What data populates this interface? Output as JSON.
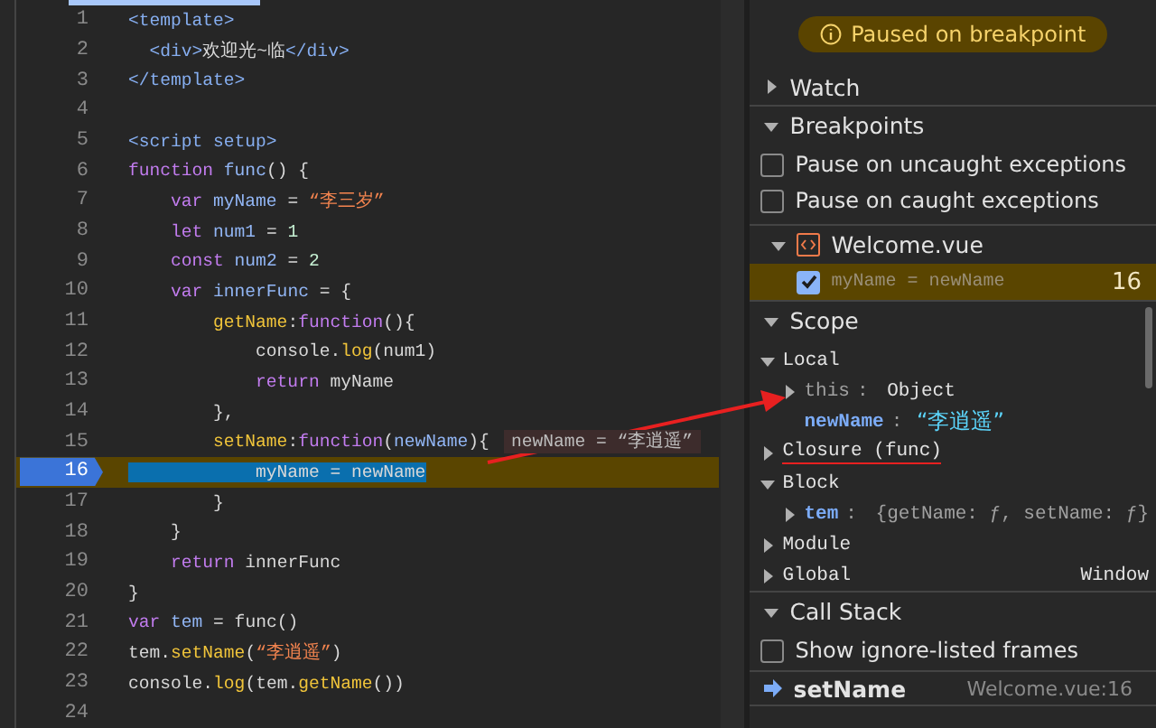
{
  "editor": {
    "lines": [
      {
        "number": "1",
        "current": false,
        "tokens": [
          {
            "text": "<template>",
            "kind": "tag"
          }
        ]
      },
      {
        "number": "2",
        "current": false,
        "tokens": [
          {
            "text": "  <div>",
            "kind": "tag"
          },
          {
            "text": "欢迎光~临",
            "kind": "plain"
          },
          {
            "text": "</div>",
            "kind": "tag"
          }
        ]
      },
      {
        "number": "3",
        "current": false,
        "tokens": [
          {
            "text": "</template>",
            "kind": "tag"
          }
        ]
      },
      {
        "number": "4",
        "current": false
      },
      {
        "number": "5",
        "current": false,
        "tokens": [
          {
            "text": "<script setup>",
            "kind": "tag"
          }
        ]
      },
      {
        "number": "6",
        "current": false,
        "tokens": [
          {
            "text": "function",
            "kind": "keyword"
          },
          {
            "text": " func",
            "kind": "ident"
          },
          {
            "text": "() {",
            "kind": "plain"
          }
        ]
      },
      {
        "number": "7",
        "current": false,
        "tokens": [
          {
            "text": "    var",
            "kind": "keyword"
          },
          {
            "text": " myName",
            "kind": "ident"
          },
          {
            "text": " = ",
            "kind": "plain"
          },
          {
            "text": "“李三岁”",
            "kind": "string"
          }
        ]
      },
      {
        "number": "8",
        "current": false,
        "tokens": [
          {
            "text": "    let",
            "kind": "keyword"
          },
          {
            "text": " num1",
            "kind": "ident"
          },
          {
            "text": " = ",
            "kind": "plain"
          },
          {
            "text": "1",
            "kind": "number"
          }
        ]
      },
      {
        "number": "9",
        "current": false,
        "tokens": [
          {
            "text": "    const",
            "kind": "keyword"
          },
          {
            "text": " num2",
            "kind": "ident"
          },
          {
            "text": " = ",
            "kind": "plain"
          },
          {
            "text": "2",
            "kind": "number"
          }
        ]
      },
      {
        "number": "10",
        "current": false,
        "tokens": [
          {
            "text": "    var",
            "kind": "keyword"
          },
          {
            "text": " innerFunc",
            "kind": "ident"
          },
          {
            "text": " = {",
            "kind": "plain"
          }
        ]
      },
      {
        "number": "11",
        "current": false,
        "tokens": [
          {
            "text": "        getName",
            "kind": "method"
          },
          {
            "text": ":",
            "kind": "plain"
          },
          {
            "text": "function",
            "kind": "keyword"
          },
          {
            "text": "(){",
            "kind": "plain"
          }
        ]
      },
      {
        "number": "12",
        "current": false,
        "tokens": [
          {
            "text": "            console.",
            "kind": "plain"
          },
          {
            "text": "log",
            "kind": "method"
          },
          {
            "text": "(num1)",
            "kind": "plain"
          }
        ]
      },
      {
        "number": "13",
        "current": false,
        "tokens": [
          {
            "text": "            return",
            "kind": "keyword"
          },
          {
            "text": " myName",
            "kind": "plain"
          }
        ]
      },
      {
        "number": "14",
        "current": false,
        "tokens": [
          {
            "text": "        },",
            "kind": "plain"
          }
        ]
      },
      {
        "number": "15",
        "current": false,
        "tokens": [
          {
            "text": "        setName",
            "kind": "method"
          },
          {
            "text": ":",
            "kind": "plain"
          },
          {
            "text": "function",
            "kind": "keyword"
          },
          {
            "text": "(",
            "kind": "plain"
          },
          {
            "text": "newName",
            "kind": "ident"
          },
          {
            "text": "){",
            "kind": "plain"
          }
        ],
        "inline_value": "newName = “李逍遥”"
      },
      {
        "number": "16",
        "current": true,
        "tokens": [
          {
            "text": "            myName = newName",
            "kind": "plain"
          }
        ]
      },
      {
        "number": "17",
        "current": false,
        "tokens": [
          {
            "text": "        }",
            "kind": "plain"
          }
        ]
      },
      {
        "number": "18",
        "current": false,
        "tokens": [
          {
            "text": "    }",
            "kind": "plain"
          }
        ]
      },
      {
        "number": "19",
        "current": false,
        "tokens": [
          {
            "text": "    return",
            "kind": "keyword"
          },
          {
            "text": " innerFunc",
            "kind": "plain"
          }
        ]
      },
      {
        "number": "20",
        "current": false,
        "tokens": [
          {
            "text": "}",
            "kind": "plain"
          }
        ]
      },
      {
        "number": "21",
        "current": false,
        "tokens": [
          {
            "text": "var",
            "kind": "keyword"
          },
          {
            "text": " tem",
            "kind": "ident"
          },
          {
            "text": " = func()",
            "kind": "plain"
          }
        ]
      },
      {
        "number": "22",
        "current": false,
        "tokens": [
          {
            "text": "tem.",
            "kind": "plain"
          },
          {
            "text": "setName",
            "kind": "method"
          },
          {
            "text": "(",
            "kind": "plain"
          },
          {
            "text": "“李逍遥”",
            "kind": "string"
          },
          {
            "text": ")",
            "kind": "plain"
          }
        ]
      },
      {
        "number": "23",
        "current": false,
        "tokens": [
          {
            "text": "console.",
            "kind": "plain"
          },
          {
            "text": "log",
            "kind": "method"
          },
          {
            "text": "(tem.",
            "kind": "plain"
          },
          {
            "text": "getName",
            "kind": "method"
          },
          {
            "text": "())",
            "kind": "plain"
          }
        ]
      },
      {
        "number": "24",
        "current": false
      }
    ]
  },
  "debugger": {
    "status": "Paused on breakpoint",
    "rows": [
      {
        "kind": "section",
        "label": "Watch",
        "expanded": false
      },
      {
        "kind": "section",
        "label": "Breakpoints",
        "expanded": true
      },
      {
        "kind": "checkbox",
        "label": "Pause on uncaught exceptions",
        "checked": false
      },
      {
        "kind": "checkbox",
        "label": "Pause on caught exceptions",
        "checked": false
      },
      {
        "kind": "file",
        "label": "Welcome.vue",
        "expanded": true
      },
      {
        "kind": "breakpoint",
        "code": "myName = newName",
        "line": "16",
        "checked": true
      },
      {
        "kind": "section",
        "label": "Scope",
        "expanded": true
      },
      {
        "kind": "scope",
        "label": "Local",
        "expanded": true,
        "children": [
          {
            "kind": "object",
            "name": "this",
            "colon": ":",
            "value": "Object",
            "expanded": false
          },
          {
            "kind": "string",
            "name": "newName",
            "colon": ":",
            "value": "“李逍遥”"
          }
        ],
        "underlined": false
      },
      {
        "kind": "scope",
        "label": "Closure (func)",
        "expanded": false,
        "underlined": true
      },
      {
        "kind": "scope",
        "label": "Block",
        "expanded": true,
        "children": [
          {
            "kind": "preview",
            "name": "tem",
            "colon": ":",
            "value": "{getName: ƒ, setName: ƒ}",
            "expanded": false
          }
        ],
        "underlined": false
      },
      {
        "kind": "scope",
        "label": "Module",
        "expanded": false,
        "underlined": false
      },
      {
        "kind": "scope",
        "label": "Global",
        "expanded": false,
        "value": "Window",
        "underlined": false
      },
      {
        "kind": "section",
        "label": "Call Stack",
        "expanded": true
      },
      {
        "kind": "checkbox",
        "label": "Show ignore-listed frames",
        "checked": false
      },
      {
        "kind": "frame",
        "function": "setName",
        "location": "Welcome.vue:16",
        "selected": true
      }
    ]
  }
}
